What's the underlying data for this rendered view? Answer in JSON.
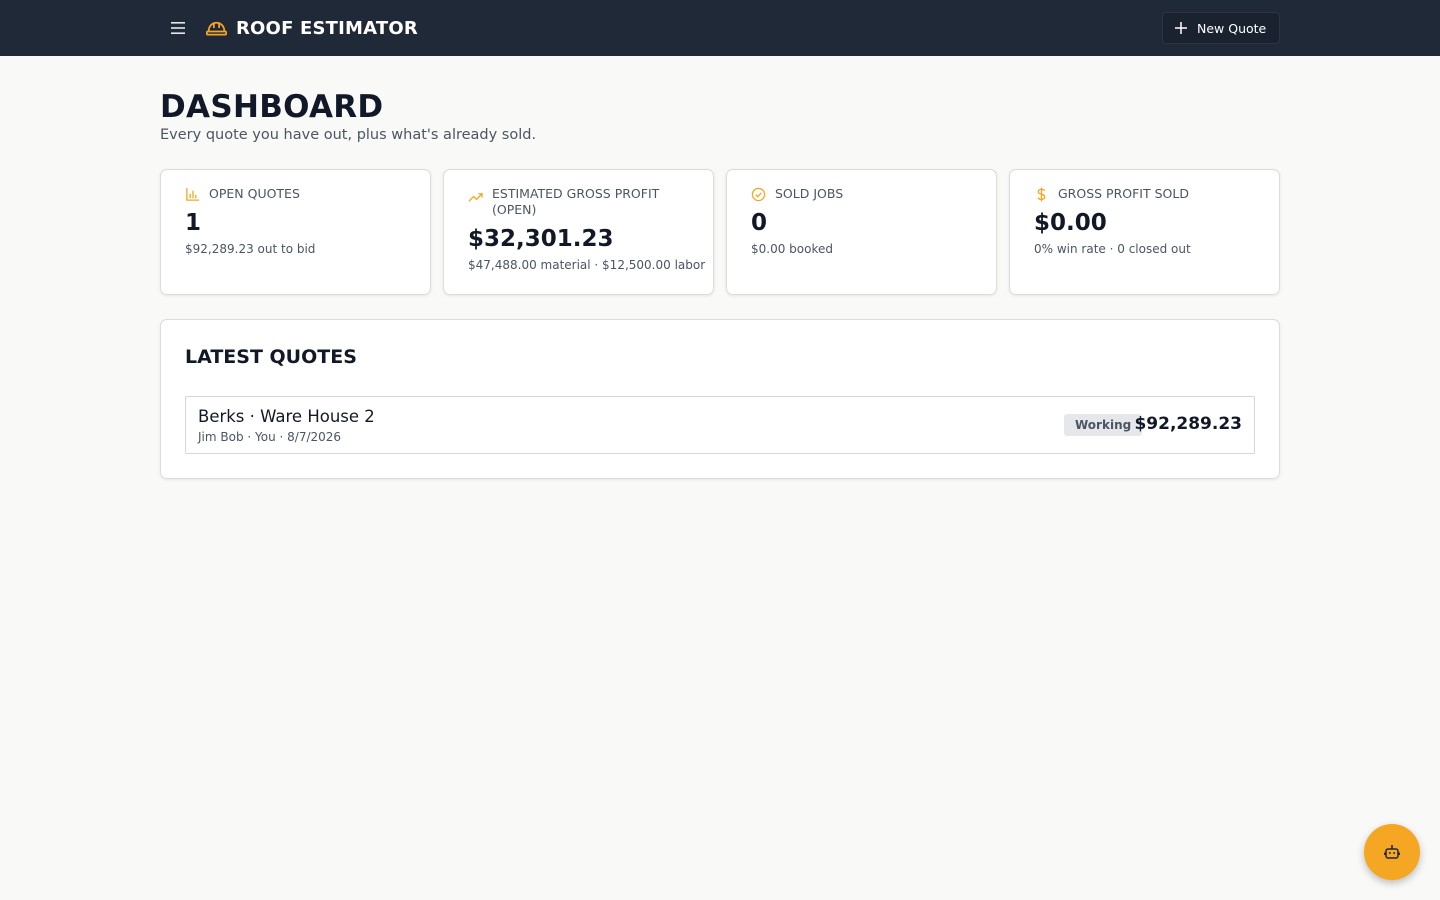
{
  "app": {
    "title": "ROOF ESTIMATOR",
    "new_quote_label": "New Quote",
    "icons": {
      "menu": "hamburger-icon",
      "brand": "hard-hat-icon",
      "new_quote": "plus-icon",
      "assistant": "bot-icon"
    },
    "accent_color": "#f5a623"
  },
  "page": {
    "title": "DASHBOARD",
    "subtitle": "Every quote you have out, plus what's already sold."
  },
  "stats": [
    {
      "label": "OPEN QUOTES",
      "icon": "bar-chart-icon",
      "value": "1",
      "sub": "$92,289.23 out to bid"
    },
    {
      "label": "ESTIMATED GROSS PROFIT (OPEN)",
      "icon": "trending-up-icon",
      "value": "$32,301.23",
      "sub": "$47,488.00 material · $12,500.00 labor"
    },
    {
      "label": "SOLD JOBS",
      "icon": "check-circle-icon",
      "value": "0",
      "sub": "$0.00 booked"
    },
    {
      "label": "GROSS PROFIT SOLD",
      "icon": "dollar-icon",
      "value": "$0.00",
      "sub": "0% win rate · 0 closed out"
    }
  ],
  "latest": {
    "title": "LATEST QUOTES",
    "quotes": [
      {
        "name": "Berks · Ware House 2",
        "meta": "Jim Bob · You · 8/7/2026",
        "status": "Working",
        "amount": "$92,289.23"
      }
    ]
  }
}
